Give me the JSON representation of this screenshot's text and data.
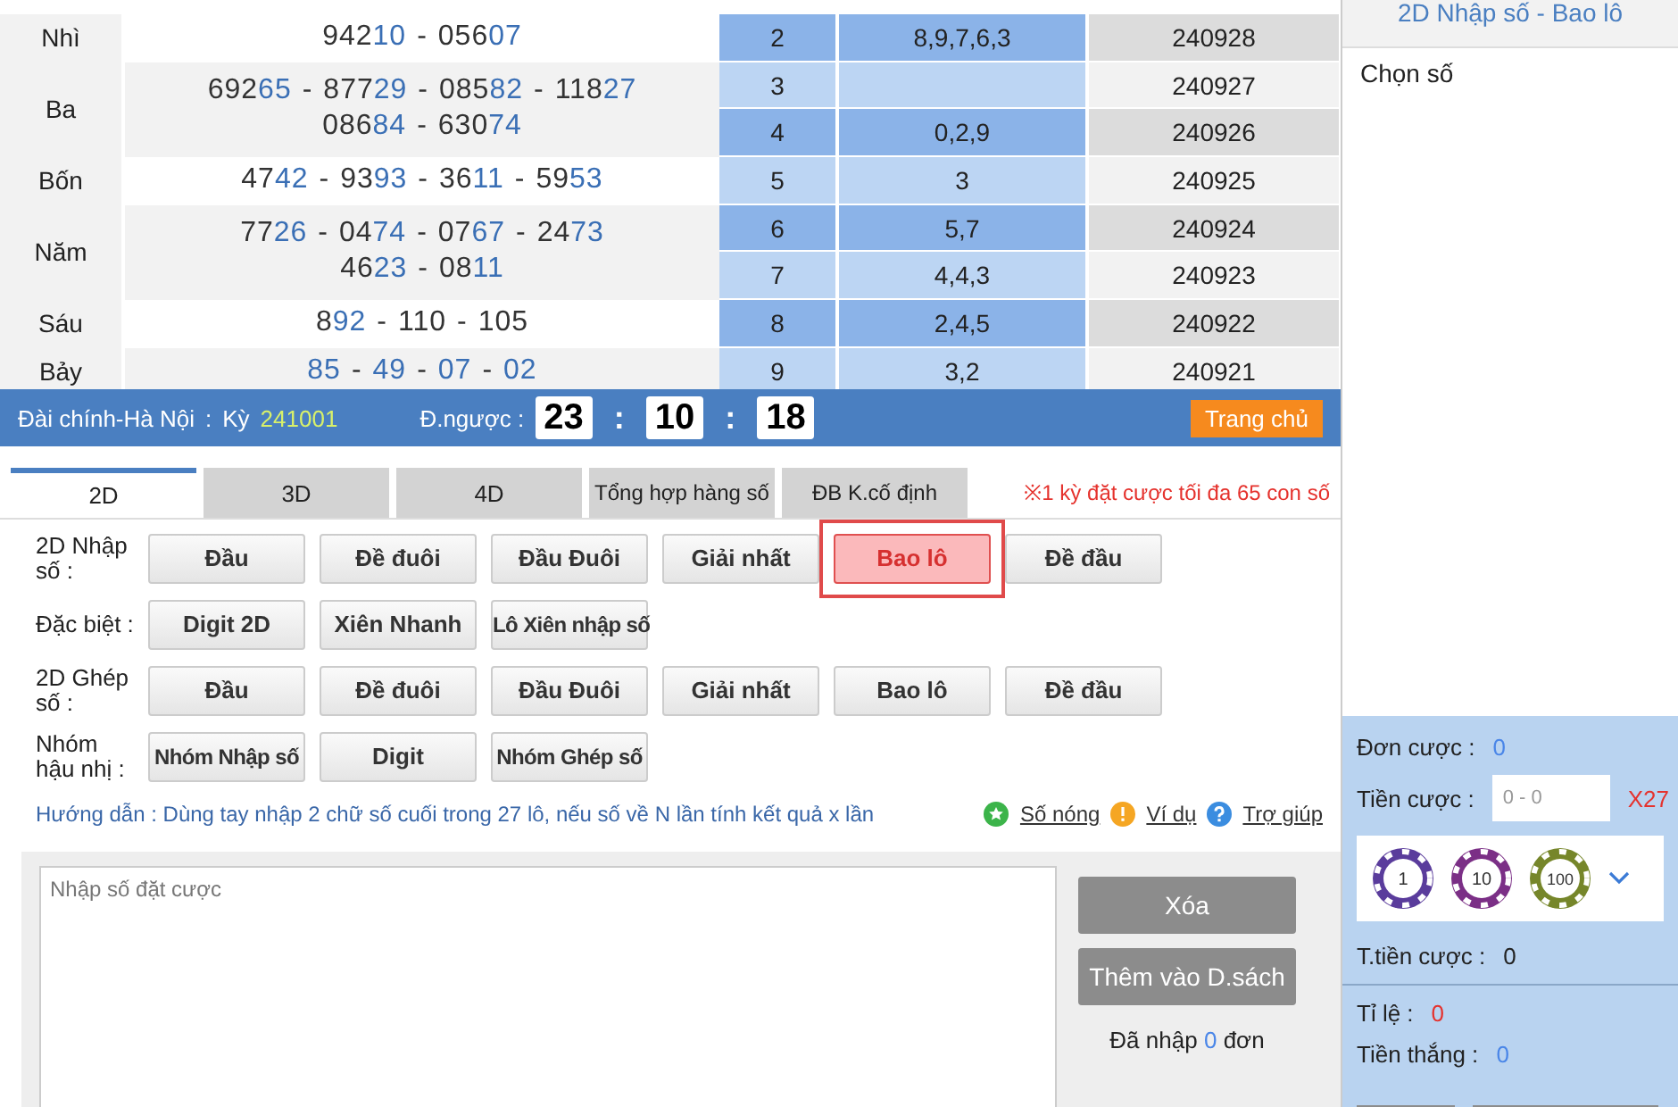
{
  "prizes": [
    {
      "label": "Nhì",
      "separator": "-",
      "lines": [
        [
          {
            "head": "942",
            "tail": "10"
          },
          {
            "head": "056",
            "tail": "07"
          }
        ]
      ]
    },
    {
      "label": "Ba",
      "separator": "-",
      "lines": [
        [
          {
            "head": "692",
            "tail": "65"
          },
          {
            "head": "877",
            "tail": "29"
          },
          {
            "head": "085",
            "tail": "82"
          },
          {
            "head": "118",
            "tail": "27"
          }
        ],
        [
          {
            "head": "086",
            "tail": "84"
          },
          {
            "head": "630",
            "tail": "74"
          }
        ]
      ]
    },
    {
      "label": "Bốn",
      "separator": "-",
      "lines": [
        [
          {
            "head": "47",
            "tail": "42"
          },
          {
            "head": "93",
            "tail": "93"
          },
          {
            "head": "36",
            "tail": "11"
          },
          {
            "head": "59",
            "tail": "53"
          }
        ]
      ]
    },
    {
      "label": "Năm",
      "separator": "-",
      "lines": [
        [
          {
            "head": "77",
            "tail": "26"
          },
          {
            "head": "04",
            "tail": "74"
          },
          {
            "head": "07",
            "tail": "67"
          },
          {
            "head": "24",
            "tail": "73"
          }
        ],
        [
          {
            "head": "46",
            "tail": "23"
          },
          {
            "head": "08",
            "tail": "11"
          }
        ]
      ]
    },
    {
      "label": "Sáu",
      "separator": "-",
      "lines": [
        [
          {
            "head": "8",
            "tail": "92"
          },
          {
            "head": "110"
          },
          {
            "head": "105"
          }
        ]
      ]
    },
    {
      "label": "Bảy",
      "separator": "-",
      "lines": [
        [
          {
            "tail": "85"
          },
          {
            "tail": "49"
          },
          {
            "tail": "07"
          },
          {
            "tail": "02"
          }
        ]
      ]
    }
  ],
  "history": [
    {
      "index": "2",
      "digits": "8,9,7,6,3",
      "date": "240928"
    },
    {
      "index": "3",
      "date": "240927"
    },
    {
      "index": "4",
      "digits": "0,2,9",
      "date": "240926"
    },
    {
      "index": "5",
      "digits": "3",
      "date": "240925"
    },
    {
      "index": "6",
      "digits": "5,7",
      "date": "240924"
    },
    {
      "index": "7",
      "digits": "4,4,3",
      "date": "240923"
    },
    {
      "index": "8",
      "digits": "2,4,5",
      "date": "240922"
    },
    {
      "index": "9",
      "digits": "3,2",
      "date": "240921"
    }
  ],
  "status_bar": {
    "station": "Đài chính-Hà Nội",
    "station_separator": ":",
    "period_label": "Kỳ",
    "period": "241001",
    "countdown_label": "Đ.ngược :",
    "countdown": [
      "23",
      "10",
      "18"
    ],
    "separator": ":",
    "home_button": "Trang chủ"
  },
  "tabs": [
    {
      "label": "2D",
      "selected": true
    },
    {
      "label": "3D",
      "selected": false
    },
    {
      "label": "4D",
      "selected": false
    },
    {
      "label": "Tổng hợp hàng số",
      "selected": false
    },
    {
      "label": "ĐB K.cố định",
      "selected": false
    }
  ],
  "limit_note": "※1 kỳ đặt cược tối đa 65 con số",
  "bet_groups": [
    {
      "label": "2D Nhập số :",
      "buttons": [
        {
          "label": "Đầu",
          "selected": false
        },
        {
          "label": "Đề đuôi",
          "selected": false
        },
        {
          "label": "Đầu Đuôi",
          "selected": false
        },
        {
          "label": "Giải nhất",
          "selected": false
        },
        {
          "label": "Bao lô",
          "selected": true,
          "highlighted": true
        },
        {
          "label": "Đề đầu",
          "selected": false
        }
      ]
    },
    {
      "label": "Đặc biệt :",
      "buttons": [
        {
          "label": "Digit 2D",
          "selected": false
        },
        {
          "label": "Xiên Nhanh",
          "selected": false
        },
        {
          "label": "Lô Xiên nhập số",
          "selected": false
        }
      ]
    },
    {
      "label": "2D Ghép số :",
      "buttons": [
        {
          "label": "Đầu",
          "selected": false
        },
        {
          "label": "Đề đuôi",
          "selected": false
        },
        {
          "label": "Đầu Đuôi",
          "selected": false
        },
        {
          "label": "Giải nhất",
          "selected": false
        },
        {
          "label": "Bao lô",
          "selected": false
        },
        {
          "label": "Đề đầu",
          "selected": false
        }
      ]
    },
    {
      "label": "Nhóm hậu nhị :",
      "buttons": [
        {
          "label": "Nhóm Nhập số",
          "selected": false
        },
        {
          "label": "Digit",
          "selected": false
        },
        {
          "label": "Nhóm Ghép số",
          "selected": false
        }
      ]
    }
  ],
  "guide": "Hướng dẫn : Dùng tay nhập 2 chữ số cuối trong 27 lô, nếu số về N lần tính kết quả x lần",
  "help_links": [
    {
      "kind": "star",
      "label": "Số nóng"
    },
    {
      "kind": "warning",
      "label": "Ví dụ"
    },
    {
      "kind": "question",
      "label": "Trợ giúp"
    }
  ],
  "entry": {
    "placeholder": "Nhập số đặt cược",
    "clear_button": "Xóa",
    "add_button": "Thêm vào D.sách",
    "count_prefix": "Đã nhập",
    "count": "0",
    "count_suffix": "đơn"
  },
  "side_panel": {
    "title": "2D Nhập số - Bao lô",
    "choose_label": "Chọn số",
    "order_label": "Đơn cược :",
    "order_value": "0",
    "stake_label": "Tiền cược :",
    "stake_placeholder": "0 - 0",
    "multiplier": "X27",
    "chips": [
      {
        "value": "1",
        "color": "#5a3c9c"
      },
      {
        "value": "10",
        "color": "#7b2f86"
      },
      {
        "value": "100",
        "color": "#76862a"
      }
    ],
    "total_label": "T.tiền cược :",
    "total_value": "0",
    "rate_label": "Tỉ lệ :",
    "rate_value": "0",
    "win_label": "Tiền thắng :",
    "win_value": "0"
  }
}
